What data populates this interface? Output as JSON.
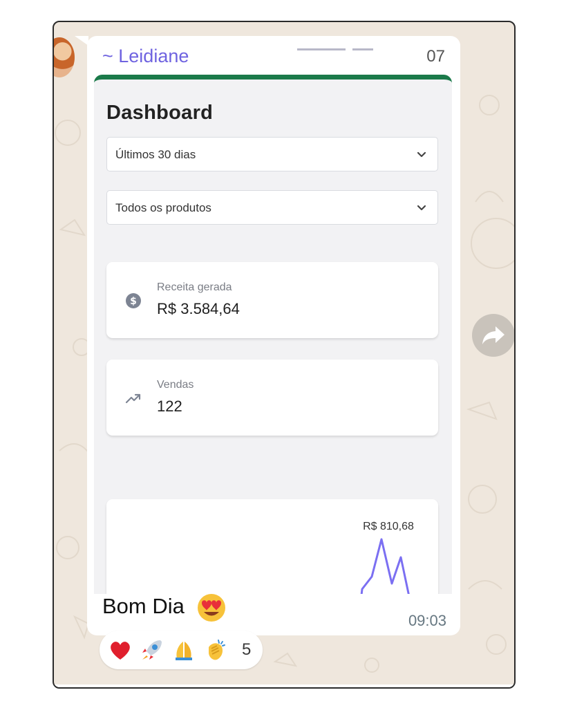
{
  "message": {
    "sender": "~ Leidiane",
    "sender_partial_right": "07",
    "caption": "Bom Dia",
    "time": "09:03"
  },
  "dashboard": {
    "title": "Dashboard",
    "period_select": "Últimos 30 dias",
    "product_select": "Todos os produtos",
    "revenue_label": "Receita gerada",
    "revenue_value": "R$  3.584,64",
    "sales_label": "Vendas",
    "sales_value": "122",
    "chart_peak_label": "R$  810,68"
  },
  "reactions": {
    "emojis": [
      "heart",
      "rocket",
      "folded-hands",
      "clapping-hands"
    ],
    "count": "5"
  },
  "colors": {
    "sender": "#6f63e0",
    "header_bar": "#1b7a4a",
    "chart_line": "#7b6ff2",
    "wallpaper": "#efe7dd"
  }
}
